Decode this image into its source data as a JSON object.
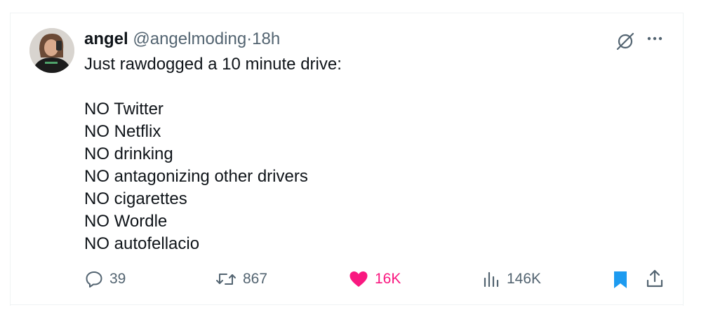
{
  "tweet": {
    "author_name": "angel",
    "handle": "@angelmoding",
    "separator": "·",
    "time": "18h",
    "lines": [
      "Just rawdogged a 10 minute drive:",
      "",
      "NO Twitter",
      "NO Netflix",
      "NO drinking",
      "NO antagonizing other drivers",
      "NO cigarettes",
      "NO Wordle",
      "NO autofellacio"
    ]
  },
  "actions": {
    "replies": "39",
    "retweets": "867",
    "likes": "16K",
    "views": "146K",
    "liked": true,
    "bookmarked": true
  },
  "colors": {
    "text": "#0f1419",
    "muted": "#536471",
    "like": "#f91880",
    "bookmark": "#1d9bf0"
  }
}
